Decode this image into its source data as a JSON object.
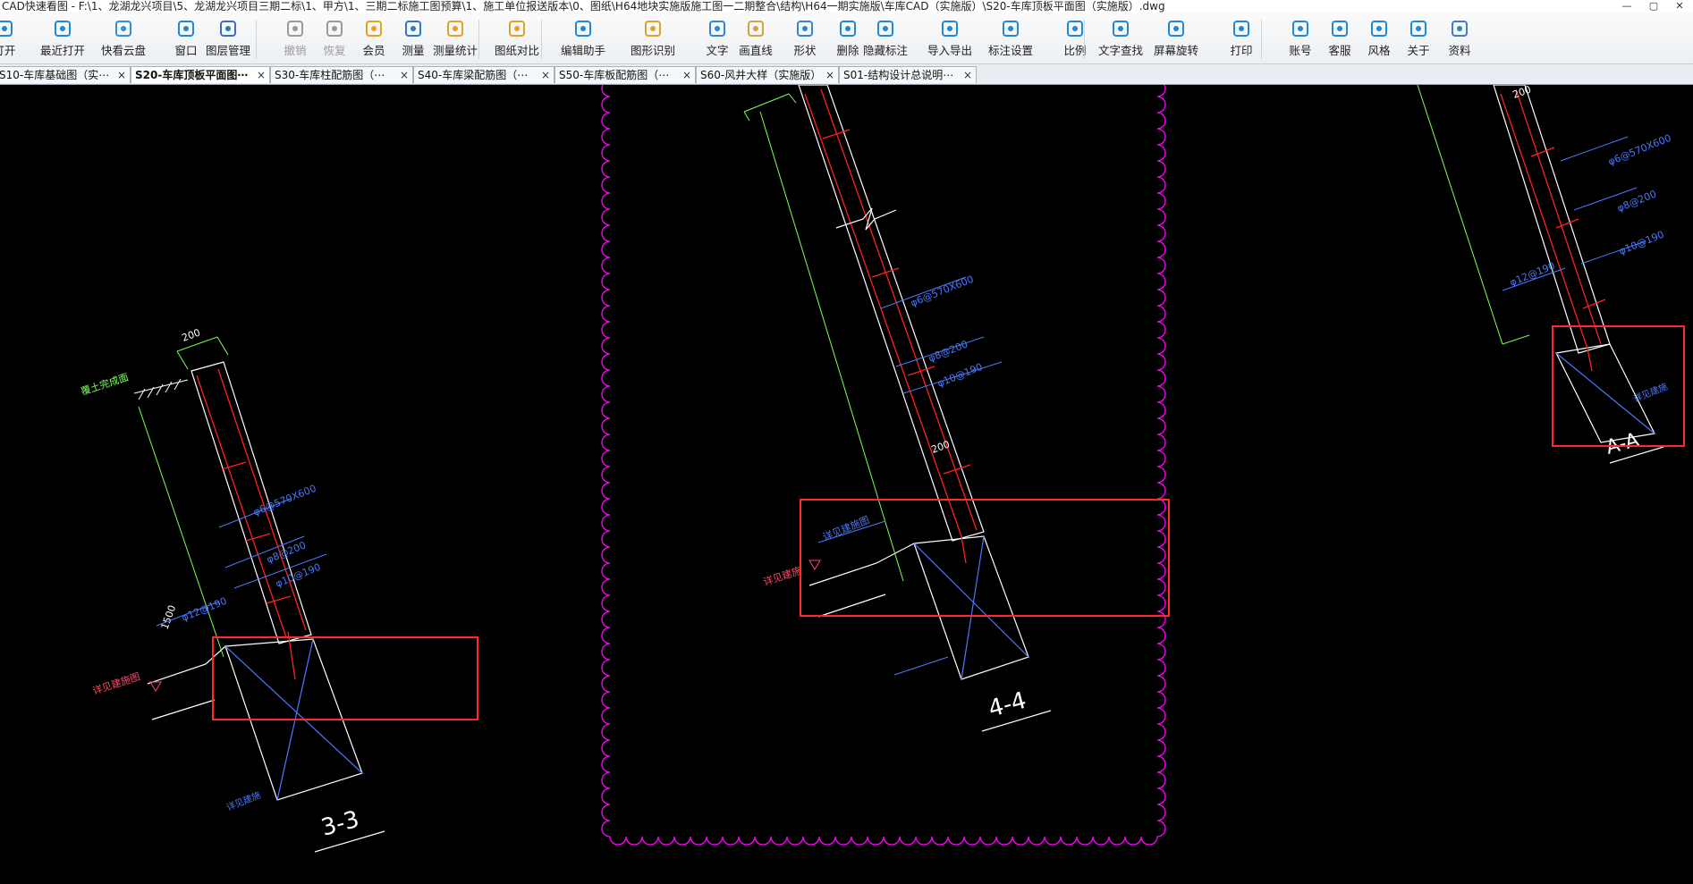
{
  "window": {
    "title": "CAD快速看图 - F:\\1、龙湖龙兴项目\\5、龙湖龙兴项目三期二标\\1、甲方\\1、三期二标施工图预算\\1、施工单位报送版本\\0、图纸\\H64地块实施版施工图一二期整合\\结构\\H64一期实施版\\车库CAD（实施版）\\S20-车库顶板平面图（实施版）.dwg"
  },
  "toolbar": {
    "items": [
      {
        "label": "打开",
        "icon": "folder-open-icon"
      },
      {
        "label": "最近打开",
        "icon": "clock-icon"
      },
      {
        "label": "快看云盘",
        "icon": "cloud-icon"
      },
      {
        "label": "窗口",
        "icon": "window-icon"
      },
      {
        "label": "图层管理",
        "icon": "layers-icon"
      },
      {
        "label": "撤销",
        "icon": "undo-icon"
      },
      {
        "label": "恢复",
        "icon": "redo-icon"
      },
      {
        "label": "会员",
        "icon": "vip-icon"
      },
      {
        "label": "测量",
        "icon": "ruler-icon"
      },
      {
        "label": "测量统计",
        "icon": "measure-stats-icon"
      },
      {
        "label": "图纸对比",
        "icon": "compare-icon"
      },
      {
        "label": "编辑助手",
        "icon": "edit-assistant-icon"
      },
      {
        "label": "图形识别",
        "icon": "shape-recognition-icon"
      },
      {
        "label": "文字",
        "icon": "text-icon"
      },
      {
        "label": "画直线",
        "icon": "line-icon"
      },
      {
        "label": "形状",
        "icon": "shape-icon"
      },
      {
        "label": "删除",
        "icon": "eraser-icon"
      },
      {
        "label": "隐藏标注",
        "icon": "eye-hidden-icon"
      },
      {
        "label": "导入导出",
        "icon": "import-export-icon"
      },
      {
        "label": "标注设置",
        "icon": "annotation-settings-icon"
      },
      {
        "label": "比例",
        "icon": "scale-icon"
      },
      {
        "label": "文字查找",
        "icon": "text-search-icon"
      },
      {
        "label": "屏幕旋转",
        "icon": "rotate-screen-icon"
      },
      {
        "label": "打印",
        "icon": "printer-icon"
      },
      {
        "label": "账号",
        "icon": "user-icon"
      },
      {
        "label": "客服",
        "icon": "headset-icon"
      },
      {
        "label": "风格",
        "icon": "style-icon"
      },
      {
        "label": "关于",
        "icon": "info-icon"
      },
      {
        "label": "资料",
        "icon": "documents-icon"
      }
    ]
  },
  "tabs": [
    {
      "label": "S10-车库基础图（实⋯",
      "active": false
    },
    {
      "label": "S20-车库顶板平面图⋯",
      "active": true
    },
    {
      "label": "S30-车库柱配筋图（⋯",
      "active": false
    },
    {
      "label": "S40-车库梁配筋图（⋯",
      "active": false
    },
    {
      "label": "S50-车库板配筋图（⋯",
      "active": false
    },
    {
      "label": "S60-风井大样（实施版）",
      "active": false
    },
    {
      "label": "S01-结构设计总说明⋯",
      "active": false
    }
  ],
  "tab_close_glyph": "×",
  "drawing": {
    "sections": [
      {
        "id": "3-3",
        "label": "3-3",
        "dim_width": "200",
        "dim_height": "1500",
        "notes": [
          "覆土完成面",
          "φ6@570X600",
          "φ8@200",
          "φ10@190",
          "φ12@190",
          "详见建施图",
          "详见建施"
        ]
      },
      {
        "id": "4-4",
        "label": "4-4",
        "dim_width": "200",
        "notes": [
          "φ6@570X600",
          "φ8@200",
          "φ10@190",
          "详见建施图",
          "详见建施"
        ]
      },
      {
        "id": "A-A",
        "label": "A-A",
        "dim_width": "200",
        "notes": [
          "φ6@570X600",
          "φ8@200",
          "φ10@190",
          "φ12@190",
          "详见建施"
        ]
      }
    ],
    "colors": {
      "background": "#000000",
      "rebar": "#ff2020",
      "wall": "#ffffff",
      "dimension": "#7cff5a",
      "annotation": "#4a78ff",
      "revision_cloud": "#ff00ff",
      "highlight_box": "#ff2a2a",
      "elevation": "#ff4a6a"
    }
  }
}
